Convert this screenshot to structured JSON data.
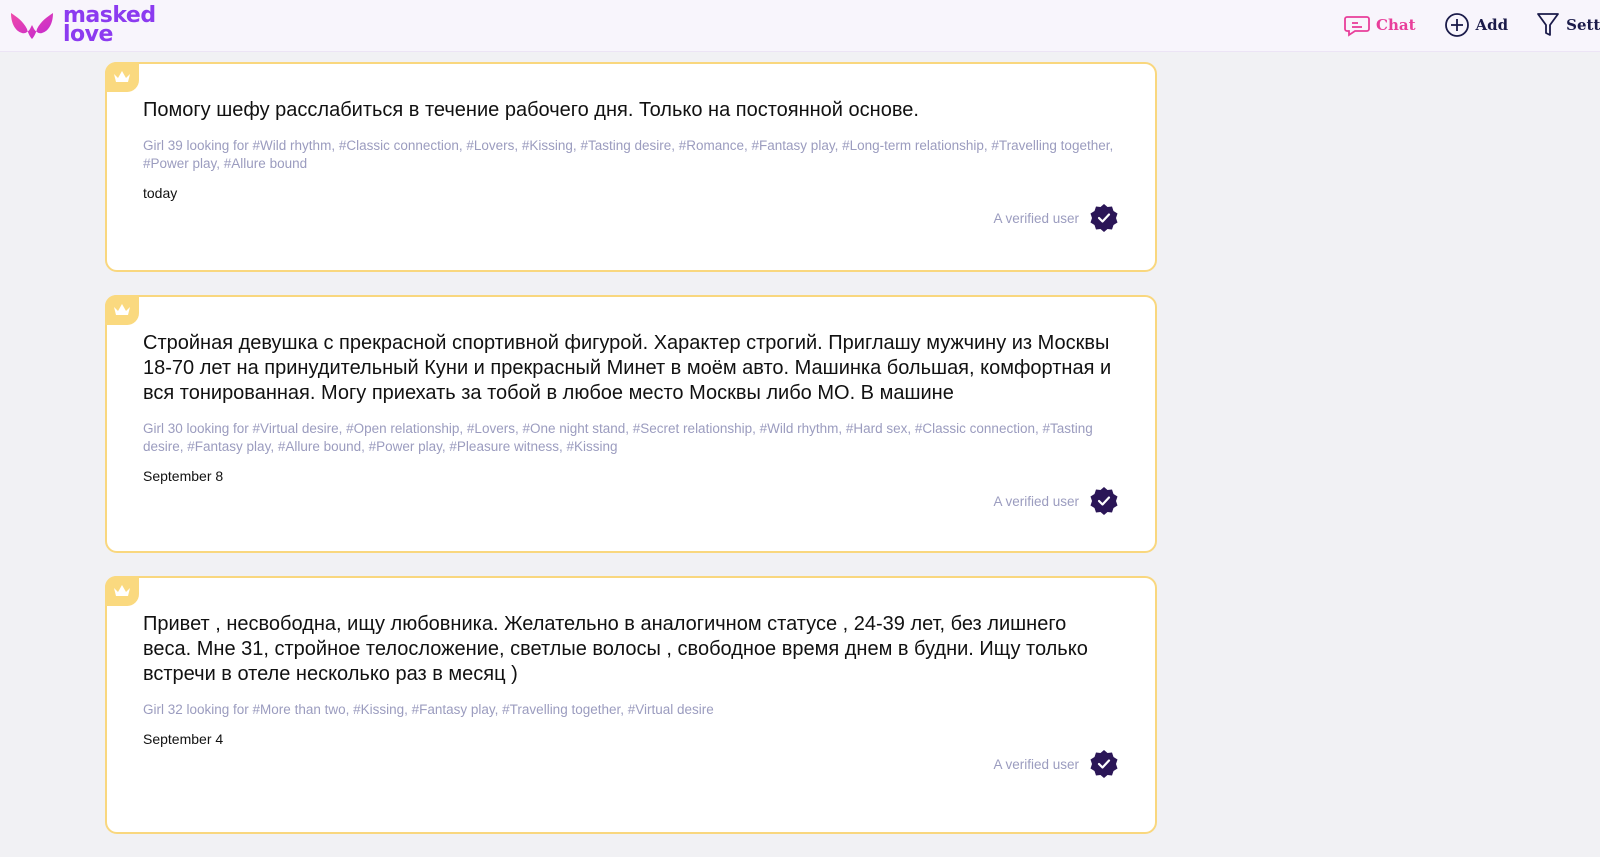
{
  "header": {
    "logo_line1": "masked",
    "logo_line2": "love",
    "nav": {
      "chat_label": "Chat",
      "add_label": "Add",
      "settings_label": "Settings"
    }
  },
  "colors": {
    "brand": "#8c3bf0",
    "chat_accent": "#e83e9a",
    "card_border": "#f9d77e",
    "tag_text": "#9b9cbf",
    "verified_badge": "#2b1657"
  },
  "listings": [
    {
      "premium": true,
      "text": "Помогу шефу расслабиться в течение рабочего дня. Только на постоянной основе.",
      "tags": "Girl 39 looking for #Wild rhythm, #Classic connection, #Lovers, #Kissing, #Tasting desire, #Romance, #Fantasy play, #Long-term relationship, #Travelling together, #Power play, #Allure bound",
      "date": "today",
      "verified_label": "A verified user"
    },
    {
      "premium": true,
      "text": "Стройная девушка с прекрасной спортивной фигурой. Характер строгий. Приглашу мужчину из Москвы 18-70 лет на принудительный Куни и прекрасный Минет в моём авто. Машинка большая, комфортная и вся тонированная. Могу приехать за тобой в любое место Москвы либо МО. В машине",
      "tags": "Girl 30 looking for #Virtual desire, #Open relationship, #Lovers, #One night stand, #Secret relationship, #Wild rhythm, #Hard sex, #Classic connection, #Tasting desire, #Fantasy play, #Allure bound, #Power play, #Pleasure witness, #Kissing",
      "date": "September 8",
      "verified_label": "A verified user"
    },
    {
      "premium": true,
      "text": "Привет , несвободна, ищу любовника. Желательно в аналогичном статусе , 24-39 лет, без лишнего веса. Мне 31, стройное телосложение, светлые волосы , свободное время днем в будни. Ищу только встречи в отеле несколько раз в месяц )",
      "tags": "Girl 32 looking for #More than two, #Kissing, #Fantasy play, #Travelling together, #Virtual desire",
      "date": "September 4",
      "verified_label": "A verified user"
    }
  ]
}
